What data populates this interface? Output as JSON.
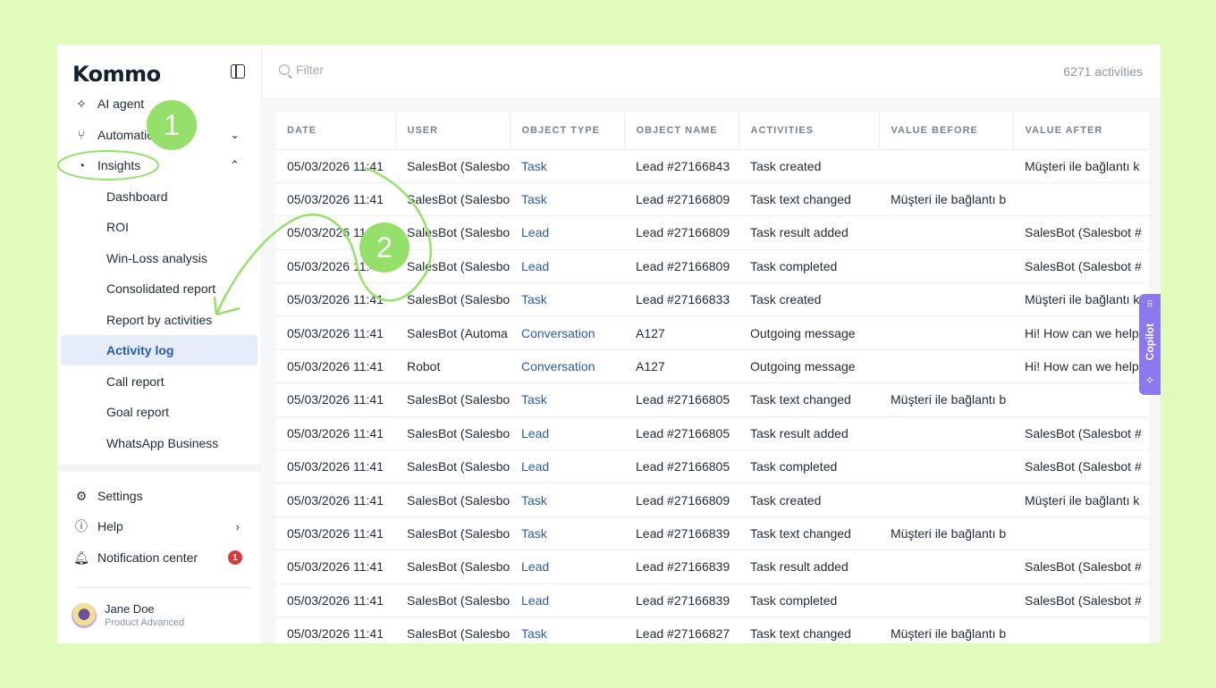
{
  "sidebar": {
    "logo": "Kommo",
    "items": [
      {
        "label": "AI agent",
        "icon": "sparkles-icon"
      },
      {
        "label": "Automation",
        "icon": "branch-icon"
      },
      {
        "label": "Insights",
        "icon": "pie-chart-icon"
      }
    ],
    "sub_items": [
      {
        "label": "Dashboard"
      },
      {
        "label": "ROI"
      },
      {
        "label": "Win-Loss analysis"
      },
      {
        "label": "Consolidated report"
      },
      {
        "label": "Report by activities"
      },
      {
        "label": "Activity log"
      },
      {
        "label": "Call report"
      },
      {
        "label": "Goal report"
      },
      {
        "label": "WhatsApp Business"
      }
    ],
    "bottom": [
      {
        "label": "Settings",
        "icon": "gear-icon"
      },
      {
        "label": "Help",
        "icon": "help-circle-icon"
      },
      {
        "label": "Notification center",
        "icon": "bell-icon",
        "badge": "1"
      }
    ],
    "user": {
      "name": "Jane Doe",
      "plan": "Product Advanced"
    }
  },
  "topbar": {
    "filter_placeholder": "Filter",
    "count": "6271 activities"
  },
  "table": {
    "columns": [
      "DATE",
      "USER",
      "OBJECT TYPE",
      "OBJECT NAME",
      "ACTIVITIES",
      "VALUE BEFORE",
      "VALUE AFTER"
    ],
    "rows": [
      [
        "05/03/2026 11:41",
        "SalesBot (Salesbo",
        "Task",
        "Lead #27166843",
        "Task created",
        "",
        "Müşteri ile bağlantı k"
      ],
      [
        "05/03/2026 11:41",
        "SalesBot (Salesbo",
        "Task",
        "Lead #27166809",
        "Task text changed",
        "Müşteri ile bağlantı b",
        ""
      ],
      [
        "05/03/2026 11:41",
        "SalesBot (Salesbo",
        "Lead",
        "Lead #27166809",
        "Task result added",
        "",
        "SalesBot (Salesbot #"
      ],
      [
        "05/03/2026 11:41",
        "SalesBot (Salesbo",
        "Lead",
        "Lead #27166809",
        "Task completed",
        "",
        "SalesBot (Salesbot #"
      ],
      [
        "05/03/2026 11:41",
        "SalesBot (Salesbo",
        "Task",
        "Lead #27166833",
        "Task created",
        "",
        "Müşteri ile bağlantı k"
      ],
      [
        "05/03/2026 11:41",
        "SalesBot (Automa",
        "Conversation",
        "A127",
        "Outgoing message",
        "",
        "Hi! How can we help"
      ],
      [
        "05/03/2026 11:41",
        "Robot",
        "Conversation",
        "A127",
        "Outgoing message",
        "",
        "Hi! How can we help"
      ],
      [
        "05/03/2026 11:41",
        "SalesBot (Salesbo",
        "Task",
        "Lead #27166805",
        "Task text changed",
        "Müşteri ile bağlantı b",
        ""
      ],
      [
        "05/03/2026 11:41",
        "SalesBot (Salesbo",
        "Lead",
        "Lead #27166805",
        "Task result added",
        "",
        "SalesBot (Salesbot #"
      ],
      [
        "05/03/2026 11:41",
        "SalesBot (Salesbo",
        "Lead",
        "Lead #27166805",
        "Task completed",
        "",
        "SalesBot (Salesbot #"
      ],
      [
        "05/03/2026 11:41",
        "SalesBot (Salesbo",
        "Task",
        "Lead #27166809",
        "Task created",
        "",
        "Müşteri ile bağlantı k"
      ],
      [
        "05/03/2026 11:41",
        "SalesBot (Salesbo",
        "Task",
        "Lead #27166839",
        "Task text changed",
        "Müşteri ile bağlantı b",
        ""
      ],
      [
        "05/03/2026 11:41",
        "SalesBot (Salesbo",
        "Lead",
        "Lead #27166839",
        "Task result added",
        "",
        "SalesBot (Salesbot #"
      ],
      [
        "05/03/2026 11:41",
        "SalesBot (Salesbo",
        "Lead",
        "Lead #27166839",
        "Task completed",
        "",
        "SalesBot (Salesbot #"
      ],
      [
        "05/03/2026 11:41",
        "SalesBot (Salesbo",
        "Task",
        "Lead #27166827",
        "Task text changed",
        "Müşteri ile bağlantı b",
        ""
      ]
    ]
  },
  "copilot": {
    "label": "Copilot"
  },
  "annotations": {
    "marker1": "1",
    "marker2": "2",
    "color": "#95e06b"
  }
}
